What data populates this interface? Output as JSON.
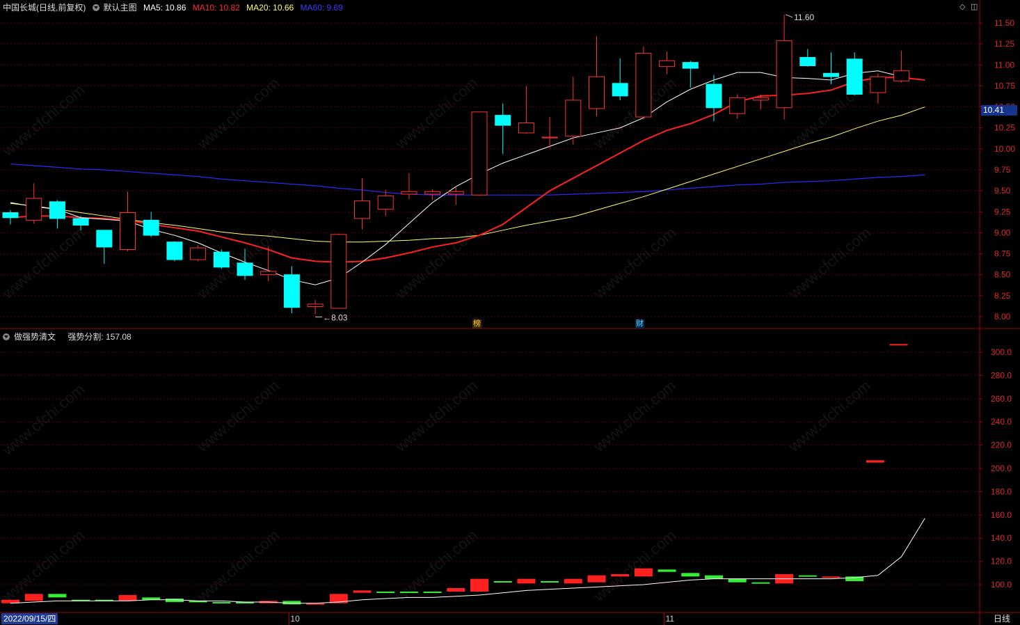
{
  "header_top": {
    "stock": "中国长城(日线,前复权)",
    "template": "默认主图",
    "ma5": "MA5: 10.86",
    "ma10": "MA10: 10.82",
    "ma20": "MA20: 10.66",
    "ma60": "MA60: 9.69"
  },
  "header_bottom": {
    "indicator": "做强势清文",
    "value": "强势分割: 157.08"
  },
  "current_price_tag": "10.41",
  "date_box": "2022/09/15/四",
  "period_label": "日线",
  "month_labels": [
    "10",
    "11"
  ],
  "markers": {
    "bang": "榜",
    "cai": "财",
    "high": "11.60",
    "low": "8.03"
  },
  "watermark": "www.cfchi.com",
  "colors": {
    "up": "#ff3232",
    "down": "#00ffff",
    "ma5": "#ffffff",
    "ma10": "#ff2020",
    "ma20": "#ffff66",
    "ma60": "#2a2aff",
    "axis": "#a00000",
    "grid": "#600000",
    "vol_up": "#ff2020",
    "vol_down": "#33ee33"
  },
  "chart_data": [
    {
      "type": "candlestick",
      "y_ticks": [
        "11.50",
        "11.25",
        "11.00",
        "10.75",
        "10.50",
        "10.25",
        "10.00",
        "9.75",
        "9.50",
        "9.25",
        "9.00",
        "8.75",
        "8.50",
        "8.25",
        "8.00"
      ],
      "ylim": [
        7.93,
        11.63
      ],
      "candles": [
        {
          "o": 9.24,
          "h": 9.27,
          "l": 9.1,
          "c": 9.18
        },
        {
          "o": 9.15,
          "h": 9.59,
          "l": 9.11,
          "c": 9.41
        },
        {
          "o": 9.37,
          "h": 9.39,
          "l": 9.05,
          "c": 9.17
        },
        {
          "o": 9.17,
          "h": 9.2,
          "l": 9.03,
          "c": 9.09
        },
        {
          "o": 9.03,
          "h": 9.03,
          "l": 8.63,
          "c": 8.83
        },
        {
          "o": 8.8,
          "h": 9.49,
          "l": 8.78,
          "c": 9.24
        },
        {
          "o": 9.15,
          "h": 9.25,
          "l": 8.95,
          "c": 8.97
        },
        {
          "o": 8.89,
          "h": 8.9,
          "l": 8.66,
          "c": 8.68
        },
        {
          "o": 8.68,
          "h": 8.85,
          "l": 8.66,
          "c": 8.82
        },
        {
          "o": 8.77,
          "h": 8.8,
          "l": 8.57,
          "c": 8.59
        },
        {
          "o": 8.64,
          "h": 8.81,
          "l": 8.44,
          "c": 8.49
        },
        {
          "o": 8.5,
          "h": 8.84,
          "l": 8.42,
          "c": 8.54
        },
        {
          "o": 8.5,
          "h": 8.6,
          "l": 8.04,
          "c": 8.11
        },
        {
          "o": 8.12,
          "h": 8.2,
          "l": 8.03,
          "c": 8.15
        },
        {
          "o": 8.1,
          "h": 8.99,
          "l": 8.1,
          "c": 8.98
        },
        {
          "o": 9.17,
          "h": 9.65,
          "l": 9.04,
          "c": 9.38
        },
        {
          "o": 9.28,
          "h": 9.51,
          "l": 9.2,
          "c": 9.44
        },
        {
          "o": 9.46,
          "h": 9.71,
          "l": 9.4,
          "c": 9.49
        },
        {
          "o": 9.46,
          "h": 9.52,
          "l": 9.39,
          "c": 9.49
        },
        {
          "o": 9.46,
          "h": 9.55,
          "l": 9.33,
          "c": 9.49
        },
        {
          "o": 9.45,
          "h": 10.35,
          "l": 9.44,
          "c": 10.44
        },
        {
          "o": 10.4,
          "h": 10.54,
          "l": 9.94,
          "c": 10.28
        },
        {
          "o": 10.19,
          "h": 10.75,
          "l": 10.18,
          "c": 10.31
        },
        {
          "o": 10.13,
          "h": 10.38,
          "l": 10.01,
          "c": 10.14
        },
        {
          "o": 10.15,
          "h": 10.86,
          "l": 10.05,
          "c": 10.58
        },
        {
          "o": 10.48,
          "h": 11.34,
          "l": 10.39,
          "c": 10.86
        },
        {
          "o": 10.78,
          "h": 11.08,
          "l": 10.58,
          "c": 10.63
        },
        {
          "o": 10.38,
          "h": 11.22,
          "l": 10.35,
          "c": 11.14
        },
        {
          "o": 10.98,
          "h": 11.16,
          "l": 10.89,
          "c": 11.05
        },
        {
          "o": 11.03,
          "h": 11.05,
          "l": 10.73,
          "c": 10.96
        },
        {
          "o": 10.77,
          "h": 10.88,
          "l": 10.33,
          "c": 10.49
        },
        {
          "o": 10.42,
          "h": 10.65,
          "l": 10.36,
          "c": 10.61
        },
        {
          "o": 10.58,
          "h": 10.65,
          "l": 10.47,
          "c": 10.61
        },
        {
          "o": 10.49,
          "h": 11.6,
          "l": 10.35,
          "c": 11.29
        },
        {
          "o": 11.09,
          "h": 11.19,
          "l": 10.98,
          "c": 10.99
        },
        {
          "o": 10.9,
          "h": 11.15,
          "l": 10.77,
          "c": 10.86
        },
        {
          "o": 11.07,
          "h": 11.15,
          "l": 10.64,
          "c": 10.65
        },
        {
          "o": 10.67,
          "h": 10.9,
          "l": 10.54,
          "c": 10.86
        },
        {
          "o": 10.81,
          "h": 11.17,
          "l": 10.79,
          "c": 10.93
        }
      ],
      "ma5": [
        9.36,
        9.31,
        9.28,
        9.18,
        9.16,
        9.14,
        9.04,
        8.97,
        8.88,
        8.76,
        8.65,
        8.55,
        8.44,
        8.38,
        8.46,
        8.65,
        8.86,
        9.11,
        9.36,
        9.55,
        9.7,
        9.83,
        9.93,
        10.03,
        10.13,
        10.19,
        10.25,
        10.37,
        10.56,
        10.71,
        10.82,
        10.91,
        10.91,
        10.85,
        10.84,
        10.82,
        10.9,
        10.93,
        10.86
      ],
      "ma10": [
        9.18,
        9.2,
        9.2,
        9.18,
        9.17,
        9.15,
        9.1,
        9.06,
        9.02,
        8.95,
        8.88,
        8.8,
        8.7,
        8.66,
        8.65,
        8.66,
        8.7,
        8.76,
        8.83,
        8.88,
        8.97,
        9.1,
        9.3,
        9.5,
        9.65,
        9.8,
        9.95,
        10.1,
        10.22,
        10.3,
        10.41,
        10.56,
        10.63,
        10.64,
        10.66,
        10.7,
        10.8,
        10.85,
        10.85,
        10.82
      ],
      "ma20": [
        9.35,
        9.32,
        9.28,
        9.24,
        9.2,
        9.16,
        9.12,
        9.09,
        9.05,
        9.01,
        8.98,
        8.96,
        8.93,
        8.9,
        8.89,
        8.89,
        8.9,
        8.91,
        8.93,
        8.94,
        8.97,
        9.03,
        9.09,
        9.14,
        9.19,
        9.27,
        9.35,
        9.43,
        9.52,
        9.61,
        9.7,
        9.79,
        9.88,
        9.97,
        10.06,
        10.14,
        10.24,
        10.33,
        10.4,
        10.5,
        10.57,
        10.66
      ],
      "ma60": [
        9.82,
        9.8,
        9.78,
        9.76,
        9.75,
        9.73,
        9.71,
        9.69,
        9.67,
        9.64,
        9.62,
        9.6,
        9.58,
        9.56,
        9.53,
        9.51,
        9.48,
        9.46,
        9.45,
        9.45,
        9.45,
        9.45,
        9.45,
        9.45,
        9.46,
        9.47,
        9.48,
        9.49,
        9.51,
        9.53,
        9.55,
        9.57,
        9.58,
        9.6,
        9.61,
        9.62,
        9.64,
        9.66,
        9.67,
        9.69
      ],
      "annotations": [
        {
          "text": "11.60",
          "at_index": 33
        },
        {
          "text": "8.03",
          "at_index": 13
        }
      ]
    },
    {
      "type": "bar",
      "title": "强势分割",
      "y_ticks": [
        "300.0",
        "280.0",
        "260.0",
        "240.0",
        "220.0",
        "200.0",
        "180.0",
        "160.0",
        "140.0",
        "120.0",
        "100.0"
      ],
      "ylim": [
        80,
        320
      ],
      "bars": [
        {
          "o": 84,
          "c": 87,
          "up": true
        },
        {
          "o": 86,
          "c": 92,
          "up": true
        },
        {
          "o": 92,
          "c": 89,
          "up": false
        },
        {
          "o": 87,
          "c": 86,
          "up": false
        },
        {
          "o": 87,
          "c": 86,
          "up": false
        },
        {
          "o": 86,
          "c": 91,
          "up": true
        },
        {
          "o": 89,
          "c": 87,
          "up": false
        },
        {
          "o": 88,
          "c": 85,
          "up": false
        },
        {
          "o": 86,
          "c": 85,
          "up": false
        },
        {
          "o": 85,
          "c": 84,
          "up": false
        },
        {
          "o": 85,
          "c": 84,
          "up": false
        },
        {
          "o": 84,
          "c": 86,
          "up": true
        },
        {
          "o": 86,
          "c": 83,
          "up": false
        },
        {
          "o": 84,
          "c": 84,
          "up": true
        },
        {
          "o": 84,
          "c": 92,
          "up": true
        },
        {
          "o": 93,
          "c": 95,
          "up": true
        },
        {
          "o": 94,
          "c": 93,
          "up": false
        },
        {
          "o": 94,
          "c": 93,
          "up": false
        },
        {
          "o": 94,
          "c": 93,
          "up": false
        },
        {
          "o": 94,
          "c": 97,
          "up": true
        },
        {
          "o": 94,
          "c": 105,
          "up": true
        },
        {
          "o": 103,
          "c": 102,
          "up": false
        },
        {
          "o": 101,
          "c": 105,
          "up": true
        },
        {
          "o": 103,
          "c": 102,
          "up": false
        },
        {
          "o": 101,
          "c": 105,
          "up": true
        },
        {
          "o": 102,
          "c": 108,
          "up": true
        },
        {
          "o": 107,
          "c": 109,
          "up": true
        },
        {
          "o": 107,
          "c": 114,
          "up": true
        },
        {
          "o": 113,
          "c": 111,
          "up": false
        },
        {
          "o": 110,
          "c": 107,
          "up": false
        },
        {
          "o": 108,
          "c": 105,
          "up": false
        },
        {
          "o": 105,
          "c": 102,
          "up": false
        },
        {
          "o": 102,
          "c": 101,
          "up": false
        },
        {
          "o": 101,
          "c": 109,
          "up": true
        },
        {
          "o": 108,
          "c": 108,
          "up": false
        },
        {
          "o": 107,
          "c": 107,
          "up": true
        },
        {
          "o": 107,
          "c": 103,
          "up": false
        },
        {
          "o": 205,
          "c": 207,
          "up": true
        },
        {
          "o": 306,
          "c": 307,
          "up": true
        }
      ],
      "line": [
        84,
        85,
        86,
        86,
        86,
        86,
        87,
        87,
        86,
        86,
        85,
        85,
        84,
        84,
        85,
        87,
        88,
        89,
        89,
        90,
        91,
        93,
        95,
        96,
        97,
        98,
        99,
        100,
        102,
        104,
        105,
        105,
        105,
        105,
        105,
        105,
        106,
        108,
        124,
        157.08
      ]
    }
  ]
}
